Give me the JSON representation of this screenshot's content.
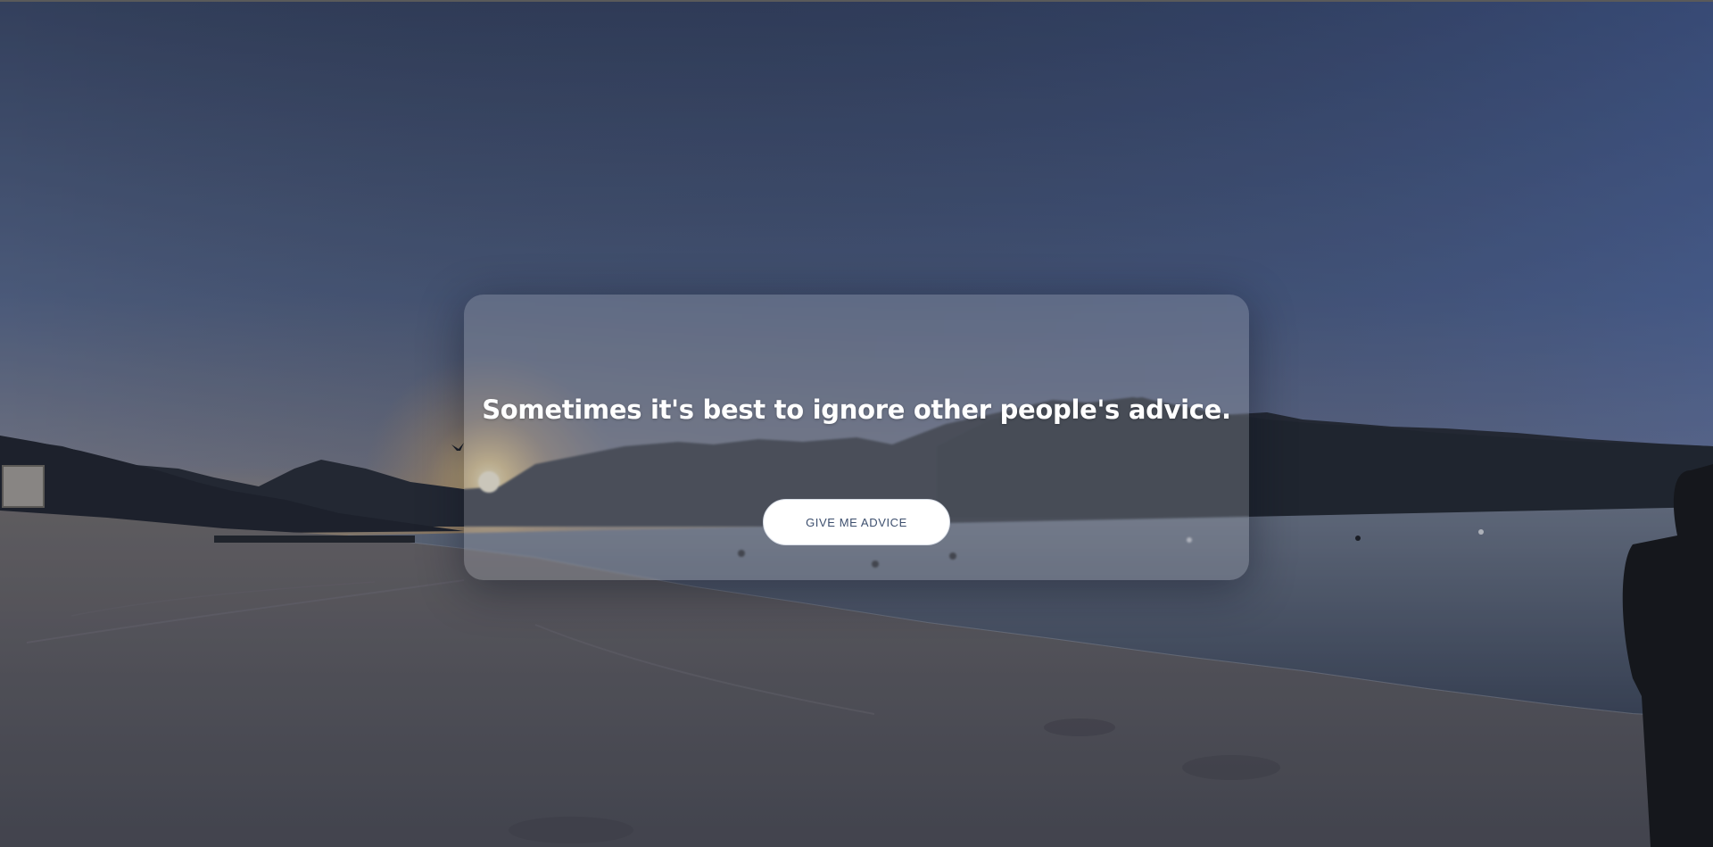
{
  "quote": {
    "text": "Sometimes it's best to ignore other people's advice."
  },
  "actions": {
    "advice_button_label": "GIVE ME ADVICE"
  },
  "colors": {
    "button_text": "#3d4f6e",
    "quote_text": "#ffffff",
    "sky_top": "#3c4c6e",
    "sky_horizon": "#c9a46a"
  }
}
